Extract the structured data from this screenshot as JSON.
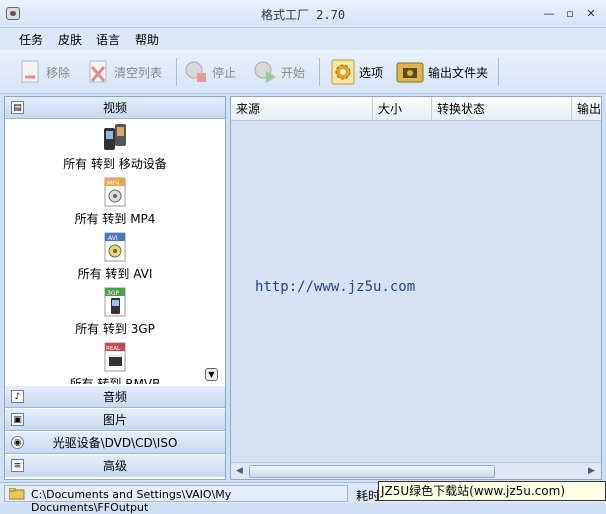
{
  "window": {
    "title": "格式工厂 2.70"
  },
  "menu": [
    "任务",
    "皮肤",
    "语言",
    "帮助"
  ],
  "toolbar": {
    "remove": "移除",
    "clear": "清空列表",
    "stop": "停止",
    "start": "开始",
    "options": "选项",
    "output_folder": "输出文件夹"
  },
  "categories": {
    "video": "视频",
    "audio": "音频",
    "picture": "图片",
    "rom": "光驱设备\\DVD\\CD\\ISO",
    "advanced": "高级"
  },
  "video_items": [
    {
      "label": "所有 转到 移动设备",
      "icon": "mobile-device-icon"
    },
    {
      "label": "所有 转到 MP4",
      "icon": "mp4-icon",
      "badge": "MP4"
    },
    {
      "label": "所有 转到 AVI",
      "icon": "avi-icon",
      "badge": "AVI"
    },
    {
      "label": "所有 转到 3GP",
      "icon": "3gp-icon",
      "badge": "3GP"
    },
    {
      "label": "所有 转到 RMVB",
      "icon": "rmvb-icon",
      "badge": "REAL"
    }
  ],
  "table": {
    "columns": [
      "来源",
      "大小",
      "转换状态",
      "输出"
    ]
  },
  "watermark_url": "http://www.jz5u.com",
  "status": {
    "output_path": "C:\\Documents and Settings\\VAIO\\My Documents\\FFOutput",
    "elapsed_label": "耗时",
    "site_banner": "JZ5U绿色下载站(www.jz5u.com)"
  }
}
